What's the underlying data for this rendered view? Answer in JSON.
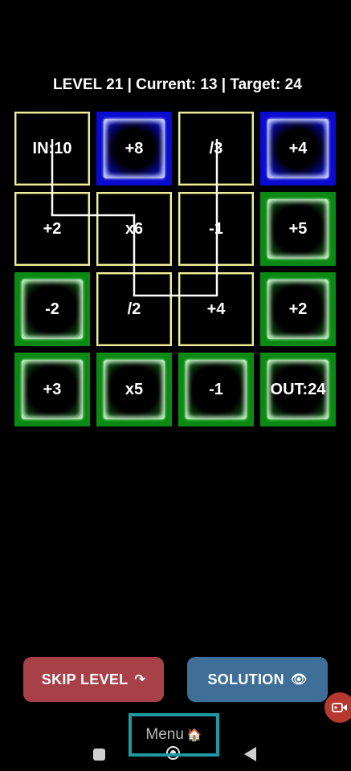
{
  "status": {
    "text": "LEVEL 21 | Current: 13 | Target: 24"
  },
  "grid": {
    "rows": [
      [
        {
          "label": "IN:10",
          "style": "plain"
        },
        {
          "label": "+8",
          "style": "blue"
        },
        {
          "label": "/3",
          "style": "plain"
        },
        {
          "label": "+4",
          "style": "blue"
        }
      ],
      [
        {
          "label": "+2",
          "style": "plain"
        },
        {
          "label": "x6",
          "style": "plain"
        },
        {
          "label": "-1",
          "style": "plain"
        },
        {
          "label": "+5",
          "style": "green"
        }
      ],
      [
        {
          "label": "-2",
          "style": "green"
        },
        {
          "label": "/2",
          "style": "plain"
        },
        {
          "label": "+4",
          "style": "plain"
        },
        {
          "label": "+2",
          "style": "green"
        }
      ],
      [
        {
          "label": "+3",
          "style": "green"
        },
        {
          "label": "x5",
          "style": "green"
        },
        {
          "label": "-1",
          "style": "green"
        },
        {
          "label": "OUT:24",
          "style": "green"
        }
      ]
    ],
    "path_cells": [
      [
        0,
        0
      ],
      [
        1,
        0
      ],
      [
        1,
        1
      ],
      [
        2,
        1
      ],
      [
        2,
        2
      ],
      [
        1,
        2
      ],
      [
        0,
        2
      ]
    ]
  },
  "buttons": {
    "skip_label": "SKIP LEVEL",
    "skip_icon": "↷",
    "solution_label": "SOLUTION",
    "solution_icon": "👁",
    "menu_label": "Menu",
    "menu_icon": "🏠"
  },
  "colors": {
    "tile_border": "#f2ef9a",
    "green": "#0a8a12",
    "blue": "#0a0ad0",
    "skip_bg": "#a84048",
    "solution_bg": "#3f6f98",
    "menu_border": "#1e98a2"
  }
}
